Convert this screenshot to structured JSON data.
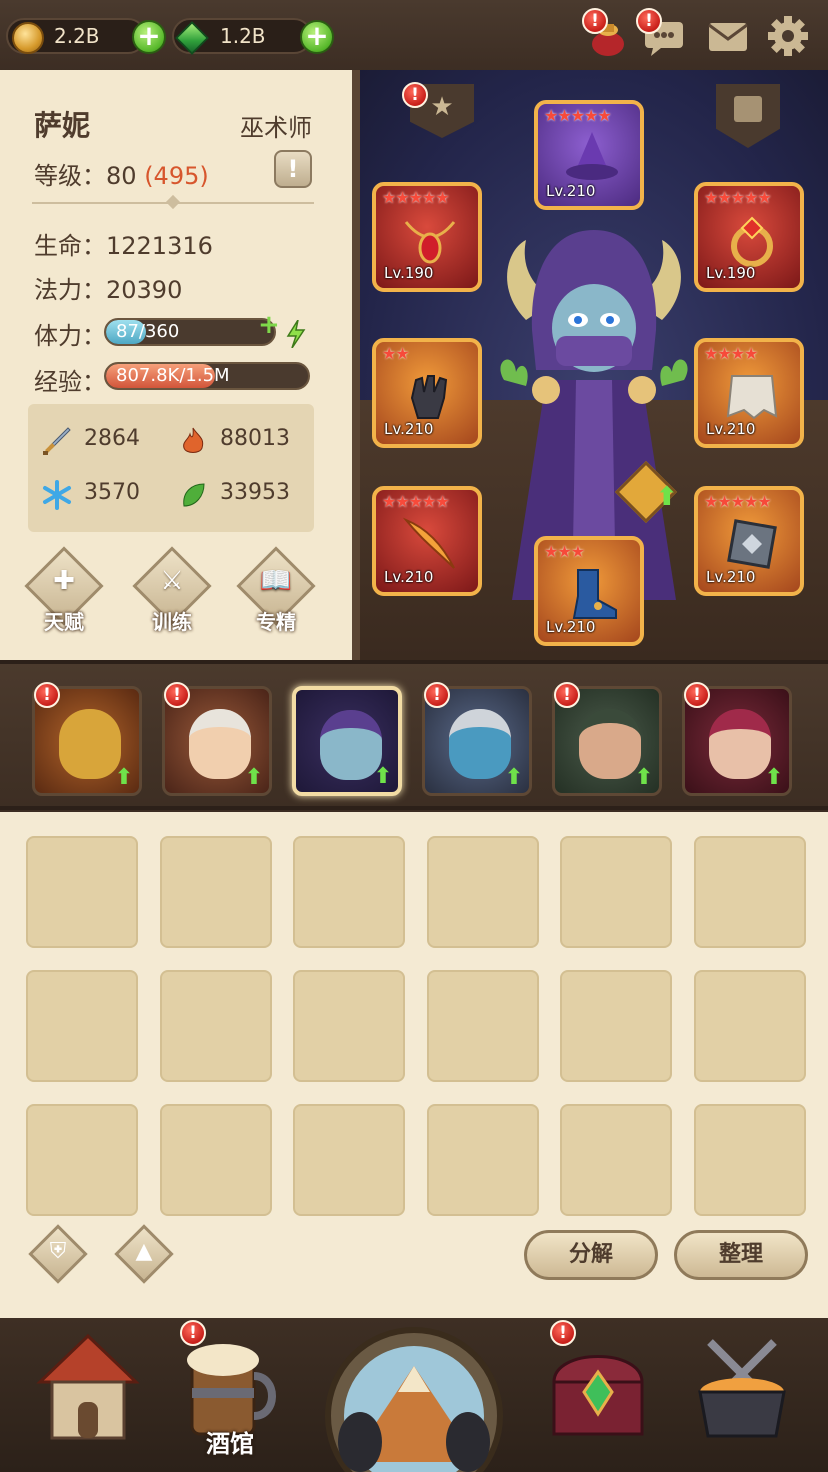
{
  "topbar": {
    "gold": "2.2B",
    "gems": "1.2B",
    "icons": [
      "coin-icon",
      "gem-icon",
      "plus-icon",
      "bundle-icon",
      "chat-icon",
      "mail-icon",
      "gear-icon"
    ]
  },
  "hero": {
    "name": "萨妮",
    "class": "巫术师",
    "level_label": "等级：",
    "level": "80",
    "level_extra": "(495)",
    "info_button": "!",
    "hp_label": "生命：",
    "hp": "1221316",
    "mp_label": "法力：",
    "mp": "20390",
    "stamina_label": "体力：",
    "stamina_text": "87/360",
    "stamina_fraction": 0.24,
    "exp_label": "经验：",
    "exp_text": "807.8K/1.5M",
    "exp_fraction": 0.54,
    "attributes": {
      "attack": "2864",
      "fire": "88013",
      "frost": "3570",
      "nature": "33953"
    },
    "skill_buttons": [
      "天赋",
      "训练",
      "专精"
    ]
  },
  "equipment": [
    {
      "slot": "helmet",
      "level": "Lv.210",
      "stars": "★★★★★",
      "rarity": "purple"
    },
    {
      "slot": "amulet",
      "level": "Lv.190",
      "stars": "★★★★★",
      "rarity": "red"
    },
    {
      "slot": "ring",
      "level": "Lv.190",
      "stars": "★★★★★",
      "rarity": "red"
    },
    {
      "slot": "gloves",
      "level": "Lv.210",
      "stars": "★★",
      "rarity": "orange"
    },
    {
      "slot": "cloak",
      "level": "Lv.210",
      "stars": "★★★★",
      "rarity": "orange"
    },
    {
      "slot": "weapon",
      "level": "Lv.210",
      "stars": "★★★★★",
      "rarity": "red"
    },
    {
      "slot": "boots",
      "level": "Lv.210",
      "stars": "★★★",
      "rarity": "orange"
    },
    {
      "slot": "offhand",
      "level": "Lv.210",
      "stars": "★★★★★",
      "rarity": "orange"
    }
  ],
  "roster": [
    {
      "name": "golden-knight",
      "alert": "!",
      "upgrade": true,
      "selected": false
    },
    {
      "name": "white-haired-warrior",
      "alert": "!",
      "upgrade": true,
      "selected": false
    },
    {
      "name": "sorceress",
      "alert": "",
      "upgrade": true,
      "selected": true
    },
    {
      "name": "wolf-shaman",
      "alert": "!",
      "upgrade": true,
      "selected": false
    },
    {
      "name": "elf-hunter",
      "alert": "!",
      "upgrade": true,
      "selected": false
    },
    {
      "name": "hooded-rogue",
      "alert": "!",
      "upgrade": true,
      "selected": false
    }
  ],
  "inventory": {
    "rows": 3,
    "cols": 6,
    "decompose_label": "分解",
    "sort_label": "整理"
  },
  "nav": {
    "tavern_label": "酒馆",
    "items": [
      "house",
      "tavern",
      "adventure",
      "treasure",
      "forge"
    ]
  },
  "alerts": {
    "mark": "!"
  },
  "colors": {
    "panel": "#f3e8cf",
    "accent_red": "#d7562d",
    "stamina": "#6fc2d6",
    "exp": "#e2724a"
  }
}
